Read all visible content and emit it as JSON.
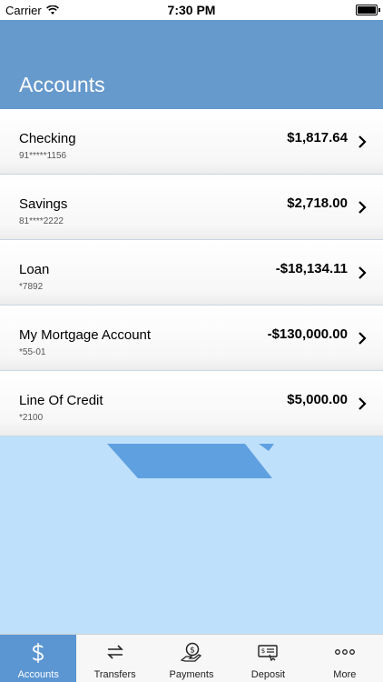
{
  "status_bar": {
    "carrier": "Carrier",
    "time": "7:30 PM"
  },
  "header": {
    "title": "Accounts"
  },
  "accounts": [
    {
      "name": "Checking",
      "number": "91*****1156",
      "balance": "$1,817.64"
    },
    {
      "name": "Savings",
      "number": "81****2222",
      "balance": "$2,718.00"
    },
    {
      "name": "Loan",
      "number": "*7892",
      "balance": "-$18,134.11"
    },
    {
      "name": "My Mortgage Account",
      "number": "*55-01",
      "balance": "-$130,000.00"
    },
    {
      "name": "Line Of Credit",
      "number": "*2100",
      "balance": "$5,000.00"
    }
  ],
  "tabs": [
    {
      "label": "Accounts",
      "icon": "dollar-icon",
      "active": true
    },
    {
      "label": "Transfers",
      "icon": "transfer-arrows-icon",
      "active": false
    },
    {
      "label": "Payments",
      "icon": "payment-hand-icon",
      "active": false
    },
    {
      "label": "Deposit",
      "icon": "check-deposit-icon",
      "active": false
    },
    {
      "label": "More",
      "icon": "ellipsis-icon",
      "active": false
    }
  ],
  "colors": {
    "header": "#6699cc",
    "background": "#bfe0fb",
    "active_tab": "#5b96d2",
    "accent_shape": "#5fa0e0"
  }
}
